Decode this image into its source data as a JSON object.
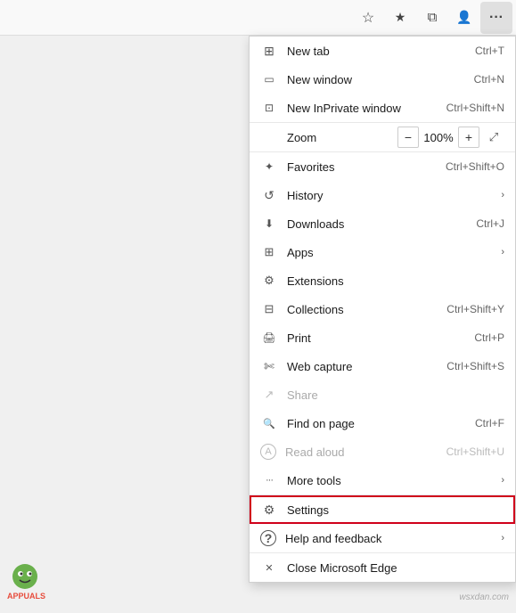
{
  "toolbar": {
    "star_icon": "star-icon",
    "favorites_icon": "star-list-icon",
    "tabs_icon": "tabs-icon",
    "user_icon": "user-icon",
    "menu_icon": "more-icon"
  },
  "menu": {
    "items": [
      {
        "id": "new-tab",
        "icon": "newtab",
        "label": "New tab",
        "shortcut": "Ctrl+T",
        "hasArrow": false,
        "disabled": false
      },
      {
        "id": "new-window",
        "icon": "window",
        "label": "New window",
        "shortcut": "Ctrl+N",
        "hasArrow": false,
        "disabled": false
      },
      {
        "id": "new-inprivate",
        "icon": "inprivate",
        "label": "New InPrivate window",
        "shortcut": "Ctrl+Shift+N",
        "hasArrow": false,
        "disabled": false
      }
    ],
    "zoom": {
      "label": "Zoom",
      "minus": "−",
      "value": "100%",
      "plus": "+",
      "expand": "⤢"
    },
    "actions": [
      {
        "id": "favorites",
        "icon": "favorites",
        "label": "Favorites",
        "shortcut": "Ctrl+Shift+O",
        "hasArrow": false,
        "disabled": false
      },
      {
        "id": "history",
        "icon": "history",
        "label": "History",
        "shortcut": "",
        "hasArrow": true,
        "disabled": false
      },
      {
        "id": "downloads",
        "icon": "downloads",
        "label": "Downloads",
        "shortcut": "Ctrl+J",
        "hasArrow": false,
        "disabled": false
      },
      {
        "id": "apps",
        "icon": "apps",
        "label": "Apps",
        "shortcut": "",
        "hasArrow": true,
        "disabled": false
      },
      {
        "id": "extensions",
        "icon": "extensions",
        "label": "Extensions",
        "shortcut": "",
        "hasArrow": false,
        "disabled": false
      },
      {
        "id": "collections",
        "icon": "collections",
        "label": "Collections",
        "shortcut": "Ctrl+Shift+Y",
        "hasArrow": false,
        "disabled": false
      },
      {
        "id": "print",
        "icon": "print",
        "label": "Print",
        "shortcut": "Ctrl+P",
        "hasArrow": false,
        "disabled": false
      },
      {
        "id": "webcapture",
        "icon": "webcapture",
        "label": "Web capture",
        "shortcut": "Ctrl+Shift+S",
        "hasArrow": false,
        "disabled": false
      },
      {
        "id": "share",
        "icon": "share",
        "label": "Share",
        "shortcut": "",
        "hasArrow": false,
        "disabled": true
      },
      {
        "id": "findonpage",
        "icon": "findonpage",
        "label": "Find on page",
        "shortcut": "Ctrl+F",
        "hasArrow": false,
        "disabled": false
      },
      {
        "id": "readaloud",
        "icon": "readaloud",
        "label": "Read aloud",
        "shortcut": "Ctrl+Shift+U",
        "hasArrow": false,
        "disabled": true
      },
      {
        "id": "moretools",
        "icon": "moretools",
        "label": "More tools",
        "shortcut": "",
        "hasArrow": true,
        "disabled": false
      },
      {
        "id": "settings",
        "icon": "settings",
        "label": "Settings",
        "shortcut": "",
        "hasArrow": false,
        "disabled": false,
        "highlighted": true
      },
      {
        "id": "help",
        "icon": "help",
        "label": "Help and feedback",
        "shortcut": "",
        "hasArrow": true,
        "disabled": false
      }
    ],
    "close": {
      "id": "close-edge",
      "label": "Close Microsoft Edge",
      "icon": "close"
    }
  },
  "watermark": "wsxdan.com"
}
